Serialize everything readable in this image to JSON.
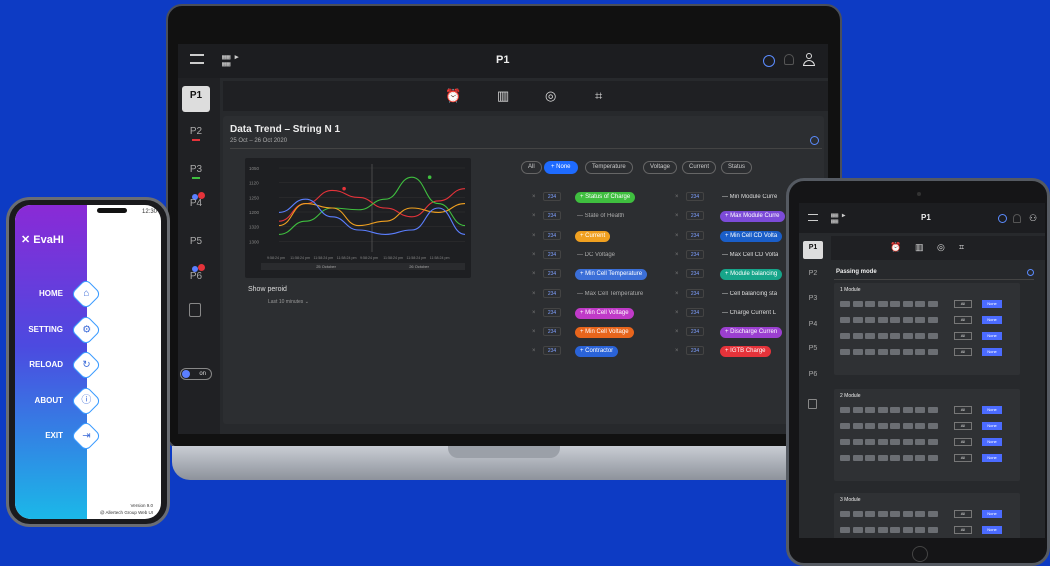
{
  "laptop": {
    "page_title": "P1",
    "side_items": [
      {
        "label": "P1",
        "active": true
      },
      {
        "label": "P2"
      },
      {
        "label": "P3"
      },
      {
        "label": "P4"
      },
      {
        "label": "P5"
      },
      {
        "label": "P6"
      }
    ],
    "toggle_label": "on",
    "panel": {
      "title": "Data Trend – String N 1",
      "subtitle": "25 Oct – 26 Oct 2020",
      "show_period_label": "Show peroid",
      "period_value": "Last 10 minutes"
    },
    "filters": [
      "All",
      "None",
      "Temperature",
      "Voltage",
      "Current",
      "Status"
    ],
    "left_rows": [
      {
        "num": "234",
        "label": "Status of Charge",
        "color": "#3fbf3f",
        "tagged": true
      },
      {
        "num": "234",
        "label": "State of Health",
        "tagged": false
      },
      {
        "num": "234",
        "label": "Current",
        "color": "#f0a020",
        "tagged": true
      },
      {
        "num": "234",
        "label": "DC Voltage",
        "tagged": false
      },
      {
        "num": "234",
        "label": "Min Cell Temperature",
        "color": "#3b6fd8",
        "tagged": true
      },
      {
        "num": "234",
        "label": "Max Cell Temperature",
        "tagged": false
      },
      {
        "num": "234",
        "label": "Min Cell Voltage",
        "color": "#c03ac8",
        "tagged": true
      },
      {
        "num": "234",
        "label": "Min Cell Voltage",
        "color": "#e8651c",
        "tagged": true
      },
      {
        "num": "234",
        "label": "Contractor",
        "color": "#2a63d8",
        "tagged": true
      }
    ],
    "right_rows": [
      {
        "num": "234",
        "label": "Min Module Curre",
        "tagged": false
      },
      {
        "num": "234",
        "label": "Max Module Curre",
        "color": "#7c4bd8",
        "tagged": true
      },
      {
        "num": "234",
        "label": "Min Cell CD Volta",
        "color": "#1a5ec8",
        "tagged": true
      },
      {
        "num": "234",
        "label": "Max Cell CD Volta",
        "tagged": false
      },
      {
        "num": "234",
        "label": "Module balancing",
        "color": "#17a58a",
        "tagged": true
      },
      {
        "num": "234",
        "label": "Cell balancing sta",
        "tagged": false
      },
      {
        "num": "234",
        "label": "Charge Current L",
        "tagged": false
      },
      {
        "num": "234",
        "label": "Discharge Curren",
        "color": "#9b3fd0",
        "tagged": true
      },
      {
        "num": "234",
        "label": "IGTB Charge",
        "color": "#e5333a",
        "tagged": true
      }
    ]
  },
  "chart_data": {
    "type": "line",
    "y_ticks": [
      "1050",
      "1120",
      "1250",
      "1200",
      "1320",
      "1300"
    ],
    "x_ticks": [
      "9:58:24 pm",
      "11:58:24 pm",
      "11:58:24 pm",
      "11:58:24 pm",
      "9:58:24 pm",
      "11:58:24 pm",
      "11:58:24 pm",
      "11:58:24 pm"
    ],
    "date_labels": [
      "25 October",
      "26 October"
    ],
    "series": [
      {
        "color": "#e5333a",
        "values": [
          0.35,
          0.55,
          0.7,
          0.62,
          0.5,
          0.4,
          0.58,
          0.72
        ]
      },
      {
        "color": "#3fbf3f",
        "values": [
          0.2,
          0.35,
          0.5,
          0.48,
          0.6,
          0.85,
          0.55,
          0.3
        ]
      },
      {
        "color": "#f0a020",
        "values": [
          0.3,
          0.55,
          0.5,
          0.3,
          0.35,
          0.5,
          0.45,
          0.55
        ]
      },
      {
        "color": "#5b7fff",
        "values": [
          0.45,
          0.6,
          0.4,
          0.25,
          0.2,
          0.25,
          0.5,
          0.2
        ]
      }
    ]
  },
  "phone": {
    "status_time": "12:30",
    "app_name": "EvaHI",
    "menu": [
      "HOME",
      "SETTING",
      "RELOAD",
      "ABOUT",
      "EXIT"
    ],
    "menu_icons": [
      "home-icon",
      "gear-icon",
      "reload-icon",
      "info-icon",
      "exit-icon"
    ],
    "version": "Version 9.0",
    "copyright": "@ Allertech Group Web UI"
  },
  "tablet": {
    "page_title": "P1",
    "side_items": [
      "P1",
      "P2",
      "P3",
      "P4",
      "P5",
      "P6"
    ],
    "section_title": "Passing mode",
    "modules": [
      "1 Module",
      "2 Module",
      "3 Module"
    ],
    "all_label": "All",
    "none_label": "None"
  }
}
